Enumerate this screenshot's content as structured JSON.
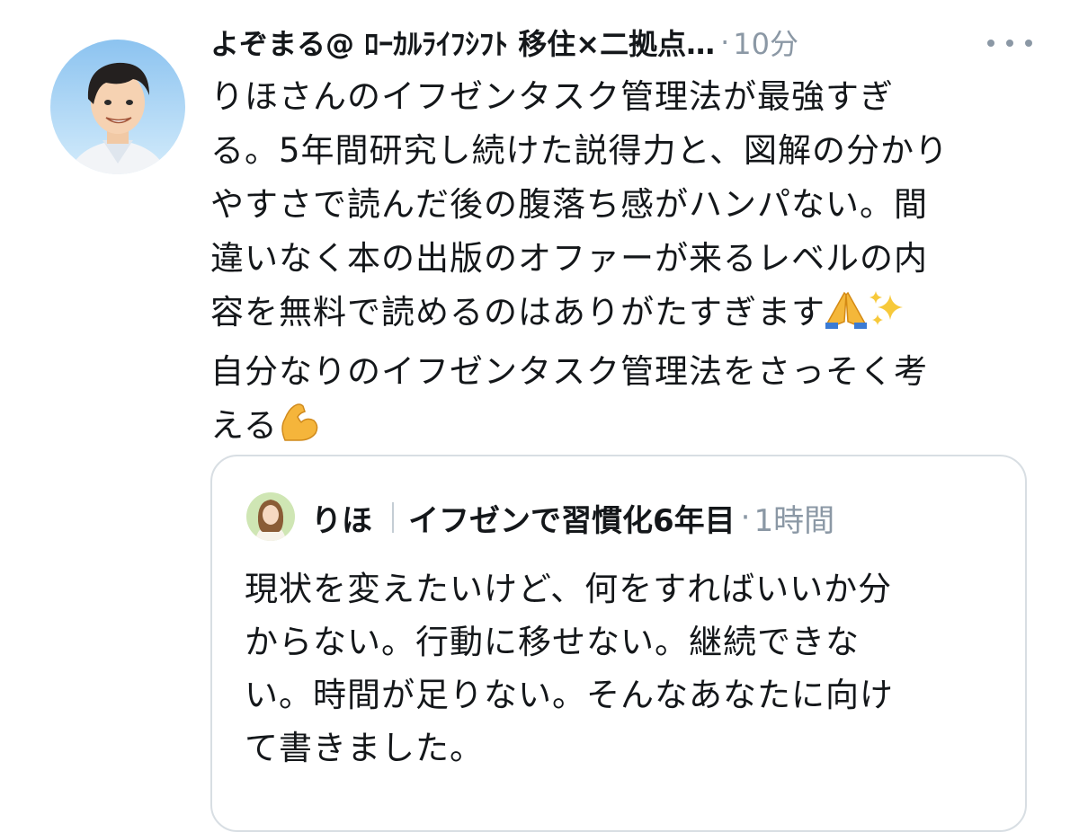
{
  "tweet": {
    "author": {
      "display_name": "よぞまる@ ﾛｰｶﾙﾗｲﾌｼﾌﾄ 移住×二拠点…",
      "avatar_icon": "avatar-illustrated-man"
    },
    "separator": "·",
    "timestamp": "10分",
    "more_icon": "more-horizontal-icon",
    "text_lines": [
      "りほさんのイフゼンタスク管理法が最強すぎ",
      "る。5年間研究し続けた説得力と、図解の分かり",
      "やすさで読んだ後の腹落ち感がハンパない。間",
      "違いなく本の出版のオファーが来るレベルの内",
      "容を無料で読めるのはありがたすぎます",
      "自分なりのイフゼンタスク管理法をさっそく考",
      "える"
    ],
    "emojis": {
      "pray": "folded-hands-emoji",
      "sparkles": "sparkles-emoji",
      "muscle": "flexed-biceps-emoji"
    }
  },
  "quoted_tweet": {
    "author_name": "りほ",
    "author_bio": "イフゼンで習慣化6年目",
    "separator": "·",
    "timestamp": "1時間",
    "avatar_icon": "avatar-photo-woman",
    "text_lines": [
      "現状を変えたいけど、何をすればいいか分",
      "からない。行動に移せない。継続できな",
      "い。時間が足りない。そんなあなたに向け",
      "て書きました。"
    ]
  },
  "colors": {
    "text_primary": "#14171a",
    "text_secondary": "#8b98a5",
    "border": "#d8dee3",
    "background": "#ffffff"
  }
}
